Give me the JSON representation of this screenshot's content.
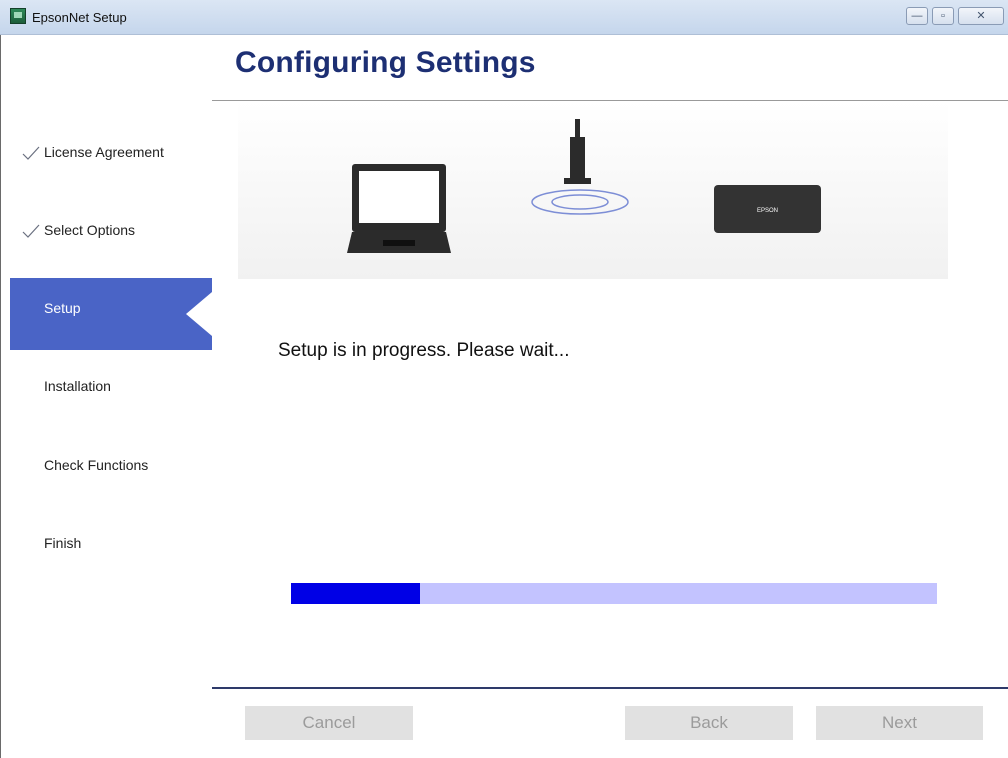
{
  "window": {
    "title": "EpsonNet Setup",
    "controls": {
      "minimize": "—",
      "maximize": "▫",
      "close": "✕"
    }
  },
  "page": {
    "heading": "Configuring Settings"
  },
  "sidebar": {
    "steps": [
      {
        "label": "License Agreement",
        "state": "completed"
      },
      {
        "label": "Select Options",
        "state": "completed"
      },
      {
        "label": "Setup",
        "state": "active"
      },
      {
        "label": "Installation",
        "state": "pending"
      },
      {
        "label": "Check Functions",
        "state": "pending"
      },
      {
        "label": "Finish",
        "state": "pending"
      }
    ]
  },
  "illustration": {
    "devices": [
      "laptop-icon",
      "access-point-icon",
      "printer-icon"
    ],
    "printer_brand": "EPSON"
  },
  "status": {
    "message": "Setup is in progress. Please wait..."
  },
  "progress": {
    "fraction": 0.2
  },
  "buttons": {
    "cancel": "Cancel",
    "back": "Back",
    "next": "Next",
    "enabled": false
  },
  "colors": {
    "active_step": "#4a64c6",
    "heading": "#1d2f73",
    "progress_fill": "#0000e6",
    "progress_track": "#c3c3ff",
    "disabled_button_text": "#9b9b9b"
  }
}
